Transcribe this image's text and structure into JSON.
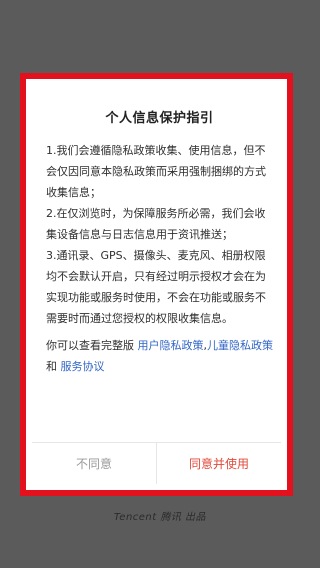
{
  "colors": {
    "overlay": "#5b5b5b",
    "highlight_frame": "#e3101d",
    "link": "#3266c6",
    "accept": "#e24a3b",
    "decline": "#9a9a9a"
  },
  "splash": {
    "footer_text": "Tencent 腾讯 出品"
  },
  "dialog": {
    "title": "个人信息保护指引",
    "paragraphs": [
      "1.我们会遵循隐私政策收集、使用信息，但不会仅因同意本隐私政策而采用强制捆绑的方式收集信息；",
      "2.在仅浏览时，为保障服务所必需，我们会收集设备信息与日志信息用于资讯推送；",
      "3.通讯录、GPS、摄像头、麦克风、相册权限均不会默认开启，只有经过明示授权才会在为实现功能或服务时使用，不会在功能或服务不需要时而通过您授权的权限收集信息。"
    ],
    "links_intro": "你可以查看完整版",
    "link_user_privacy": "用户隐私政策",
    "comma": ",",
    "link_child_privacy": "儿童隐私政策",
    "and_text": " 和 ",
    "link_service": "服务协议",
    "decline_label": "不同意",
    "accept_label": "同意并使用"
  }
}
